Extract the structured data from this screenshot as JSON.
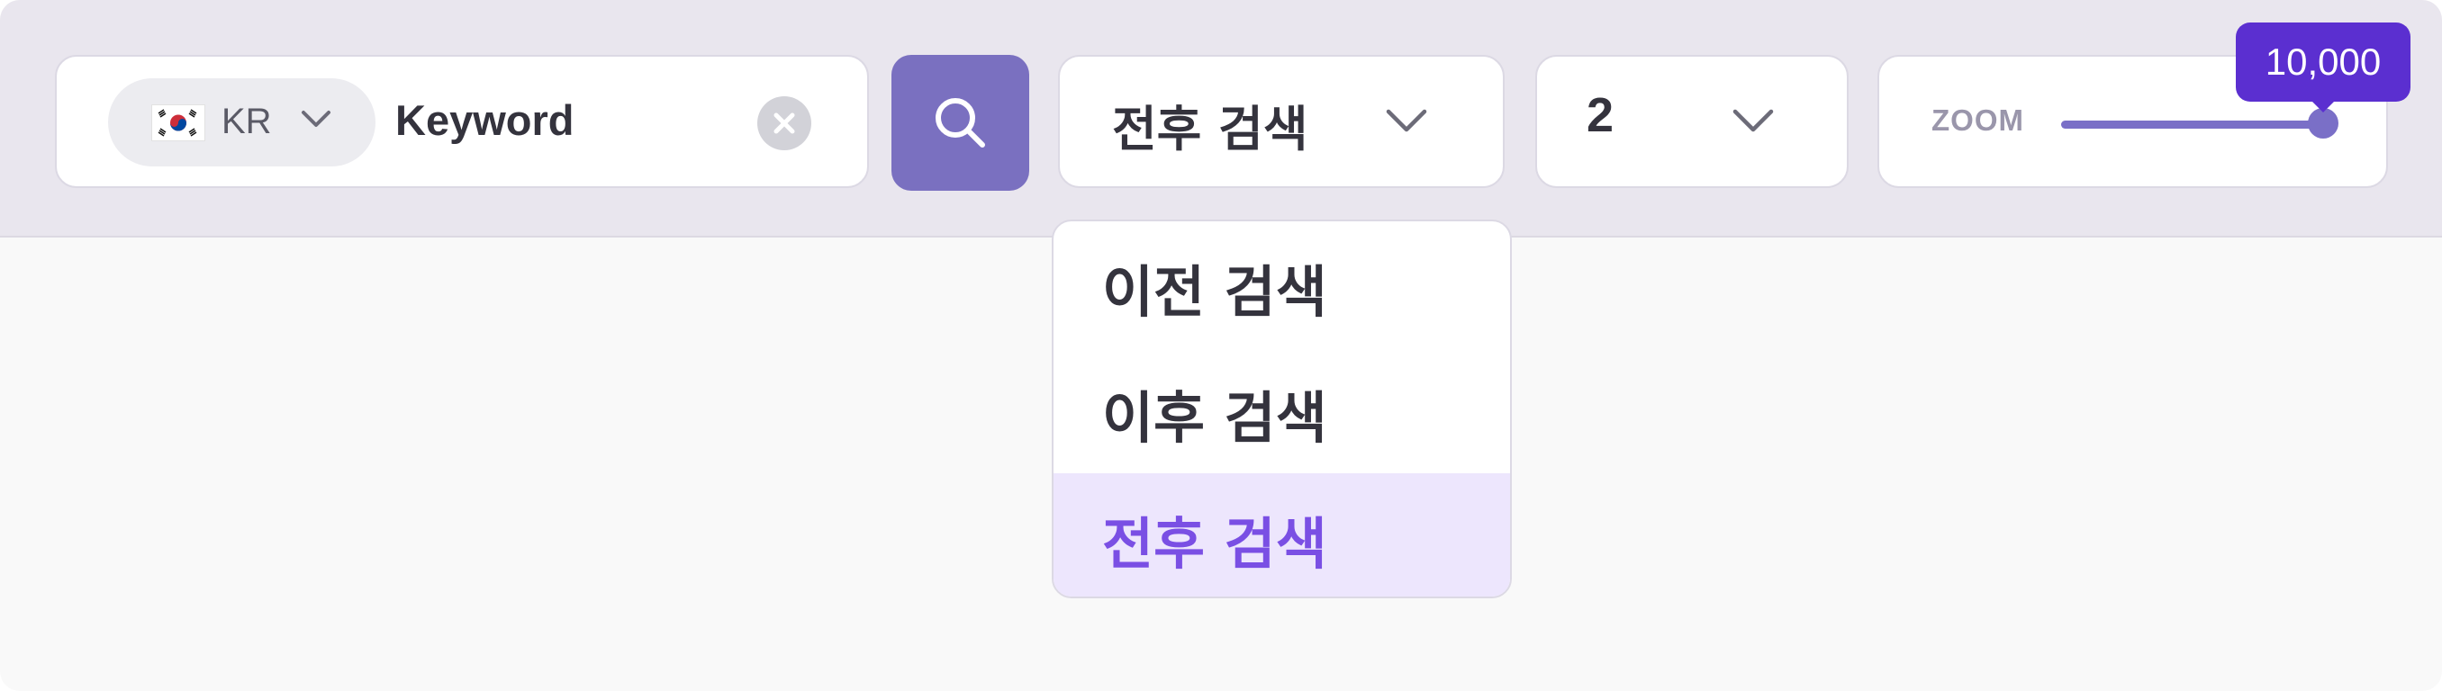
{
  "search": {
    "country_code": "KR",
    "flag_icon": "south-korea-flag-icon",
    "keyword_value": "Keyword",
    "keyword_placeholder": "Keyword"
  },
  "search_mode": {
    "selected": "전후 검색",
    "options": [
      {
        "label": "이전 검색",
        "selected": false
      },
      {
        "label": "이후 검색",
        "selected": false
      },
      {
        "label": "전후 검색",
        "selected": true
      }
    ]
  },
  "count_select": {
    "value": "2"
  },
  "zoom": {
    "label": "ZOOM",
    "tooltip": "10,000",
    "level_fraction": 1.0
  },
  "colors": {
    "accent": "#7a70c0",
    "tooltip": "#5b2fd0",
    "selected_option_bg": "#ede6fd",
    "selected_option_text": "#7a4fe4"
  }
}
